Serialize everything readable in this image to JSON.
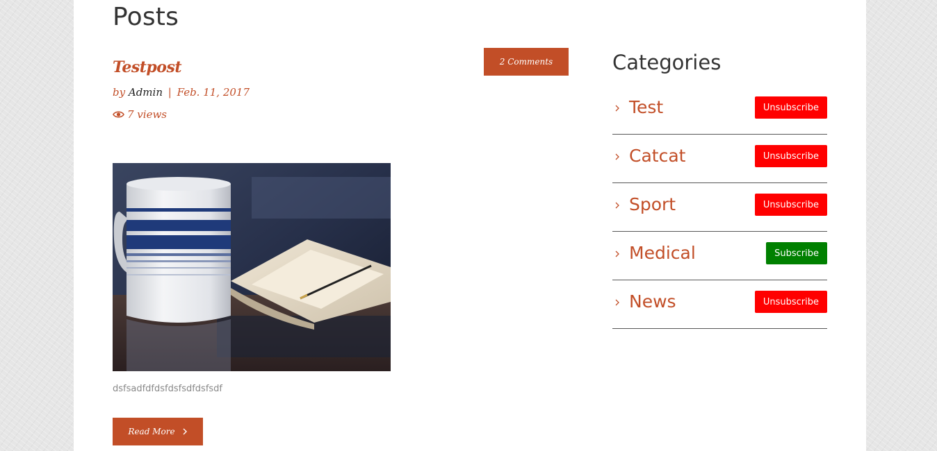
{
  "main": {
    "page_title": "Posts",
    "post": {
      "title": "Testpost",
      "by_label": "by",
      "author": "Admin",
      "separator": "|",
      "date": "Feb. 11, 2017",
      "views": "7 views",
      "comments_label": "2 Comments",
      "excerpt": "dsfsadfdfdsfdsfsdfdsfsdf",
      "read_more_label": "Read More",
      "image_icon": "mug-and-notebook-photo"
    }
  },
  "sidebar": {
    "title": "Categories",
    "categories": [
      {
        "name": "Test",
        "button": "Unsubscribe"
      },
      {
        "name": "Catcat",
        "button": "Unsubscribe"
      },
      {
        "name": "Sport",
        "button": "Unsubscribe"
      },
      {
        "name": "Medical",
        "button": "Subscribe"
      },
      {
        "name": "News",
        "button": "Unsubscribe"
      }
    ]
  },
  "colors": {
    "accent": "#c24e27",
    "unsubscribe": "#ff0000",
    "subscribe": "#008000"
  }
}
